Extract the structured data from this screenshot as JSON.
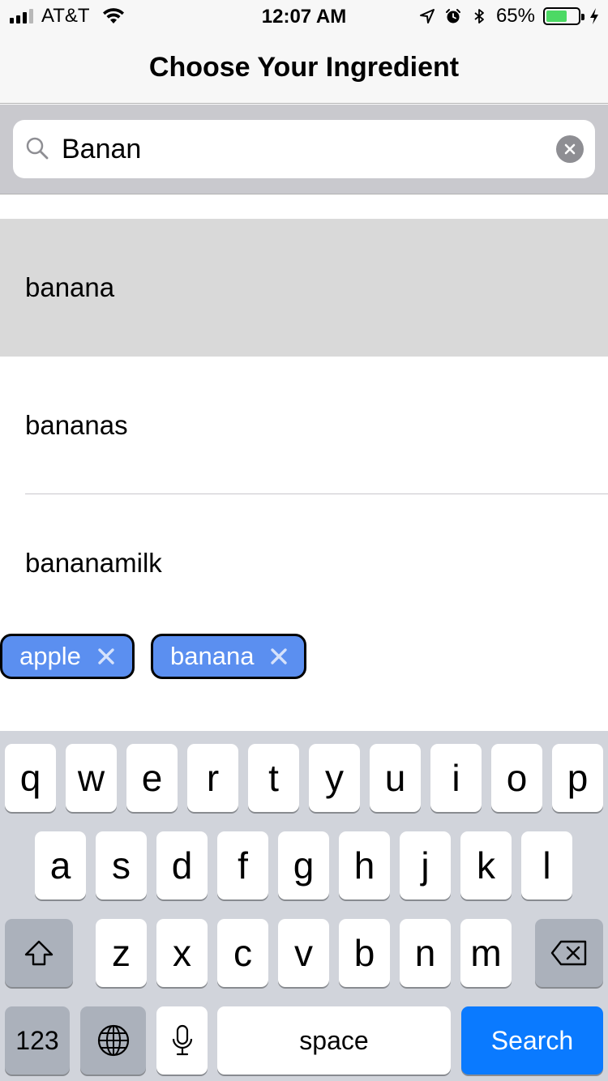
{
  "status_bar": {
    "carrier": "AT&T",
    "time": "12:07 AM",
    "battery_percent": "65%",
    "battery_level": 0.65,
    "signal_bars_active": 3,
    "icons": [
      "signal-icon",
      "wifi-icon",
      "location-arrow-icon",
      "alarm-icon",
      "bluetooth-icon",
      "battery-icon",
      "charging-bolt-icon"
    ]
  },
  "nav": {
    "title": "Choose Your Ingredient"
  },
  "search": {
    "value": "Banan",
    "icons": [
      "search-icon",
      "clear-icon"
    ]
  },
  "suggestions": [
    {
      "label": "banana",
      "selected": true
    },
    {
      "label": "bananas",
      "selected": false
    },
    {
      "label": "bananamilk",
      "selected": false
    }
  ],
  "tags": [
    {
      "label": "apple"
    },
    {
      "label": "banana"
    }
  ],
  "colors": {
    "tag_fill": "#5b8ff0",
    "search_key": "#0a7aff",
    "battery_fill": "#4cd964",
    "selected_row": "#d9d9d9"
  },
  "keyboard": {
    "row1": [
      "q",
      "w",
      "e",
      "r",
      "t",
      "y",
      "u",
      "i",
      "o",
      "p"
    ],
    "row2": [
      "a",
      "s",
      "d",
      "f",
      "g",
      "h",
      "j",
      "k",
      "l"
    ],
    "row3": [
      "z",
      "x",
      "c",
      "v",
      "b",
      "n",
      "m"
    ],
    "numbers_key": "123",
    "space_key": "space",
    "search_key": "Search",
    "icons": [
      "shift-icon",
      "backspace-icon",
      "globe-icon",
      "microphone-icon"
    ]
  }
}
